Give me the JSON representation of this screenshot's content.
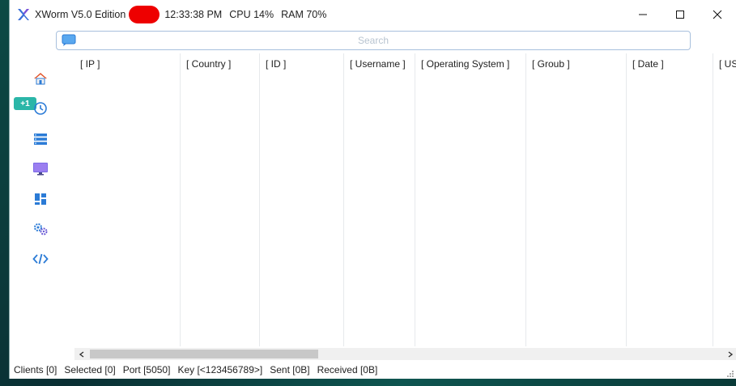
{
  "window": {
    "title": "XWorm V5.0 Edition",
    "clock": "12:33:38 PM",
    "cpu": "CPU 14%",
    "ram": "RAM 70%"
  },
  "search": {
    "placeholder": "Search"
  },
  "sidebar": {
    "badge": "+1",
    "items": [
      {
        "icon": "home-icon"
      },
      {
        "icon": "history-icon"
      },
      {
        "icon": "list-icon"
      },
      {
        "icon": "monitor-icon"
      },
      {
        "icon": "dashboard-icon"
      },
      {
        "icon": "settings-gears-icon"
      },
      {
        "icon": "code-icon"
      }
    ]
  },
  "table": {
    "columns": [
      "[ IP ]",
      "[ Country ]",
      "[ ID ]",
      "[ Username ]",
      "[ Operating System ]",
      "[ Groub ]",
      "[ Date ]",
      "[ USE"
    ],
    "rows": []
  },
  "status": {
    "clients": "Clients [0]",
    "selected": "Selected [0]",
    "port": "Port [5050]",
    "key": "Key [<123456789>]",
    "sent": "Sent [0B]",
    "received": "Received [0B]"
  },
  "colors": {
    "accent": "#2b7bd6",
    "badge": "#2bb6a8",
    "home_roof": "#e2552b"
  }
}
